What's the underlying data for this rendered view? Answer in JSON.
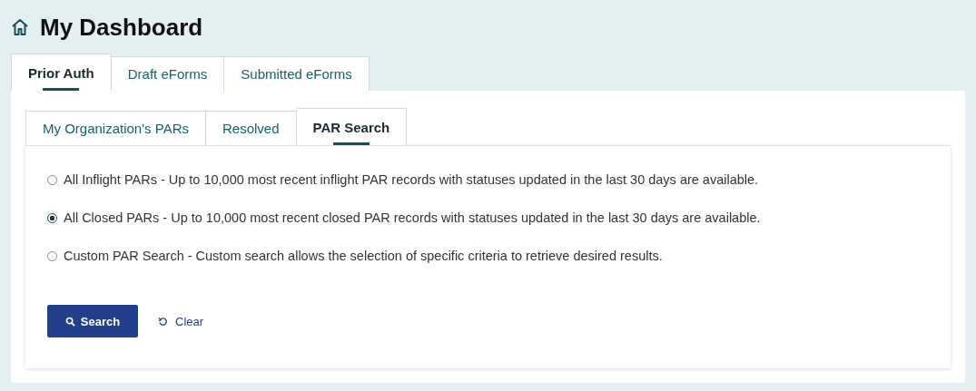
{
  "title": "My Dashboard",
  "tabs": [
    {
      "label": "Prior Auth",
      "selected": true
    },
    {
      "label": "Draft eForms",
      "selected": false
    },
    {
      "label": "Submitted eForms",
      "selected": false
    }
  ],
  "subtabs": [
    {
      "label": "My Organization's PARs",
      "selected": false
    },
    {
      "label": "Resolved",
      "selected": false
    },
    {
      "label": "PAR Search",
      "selected": true
    }
  ],
  "options": [
    {
      "label": "All Inflight PARs - Up to 10,000 most recent inflight PAR records with statuses updated in the last 30 days are available.",
      "selected": false
    },
    {
      "label": "All Closed PARs - Up to 10,000 most recent closed PAR records with statuses updated in the last 30 days are available.",
      "selected": true
    },
    {
      "label": "Custom PAR Search - Custom search allows the selection of specific criteria to retrieve desired results.",
      "selected": false
    }
  ],
  "buttons": {
    "search": "Search",
    "clear": "Clear"
  }
}
